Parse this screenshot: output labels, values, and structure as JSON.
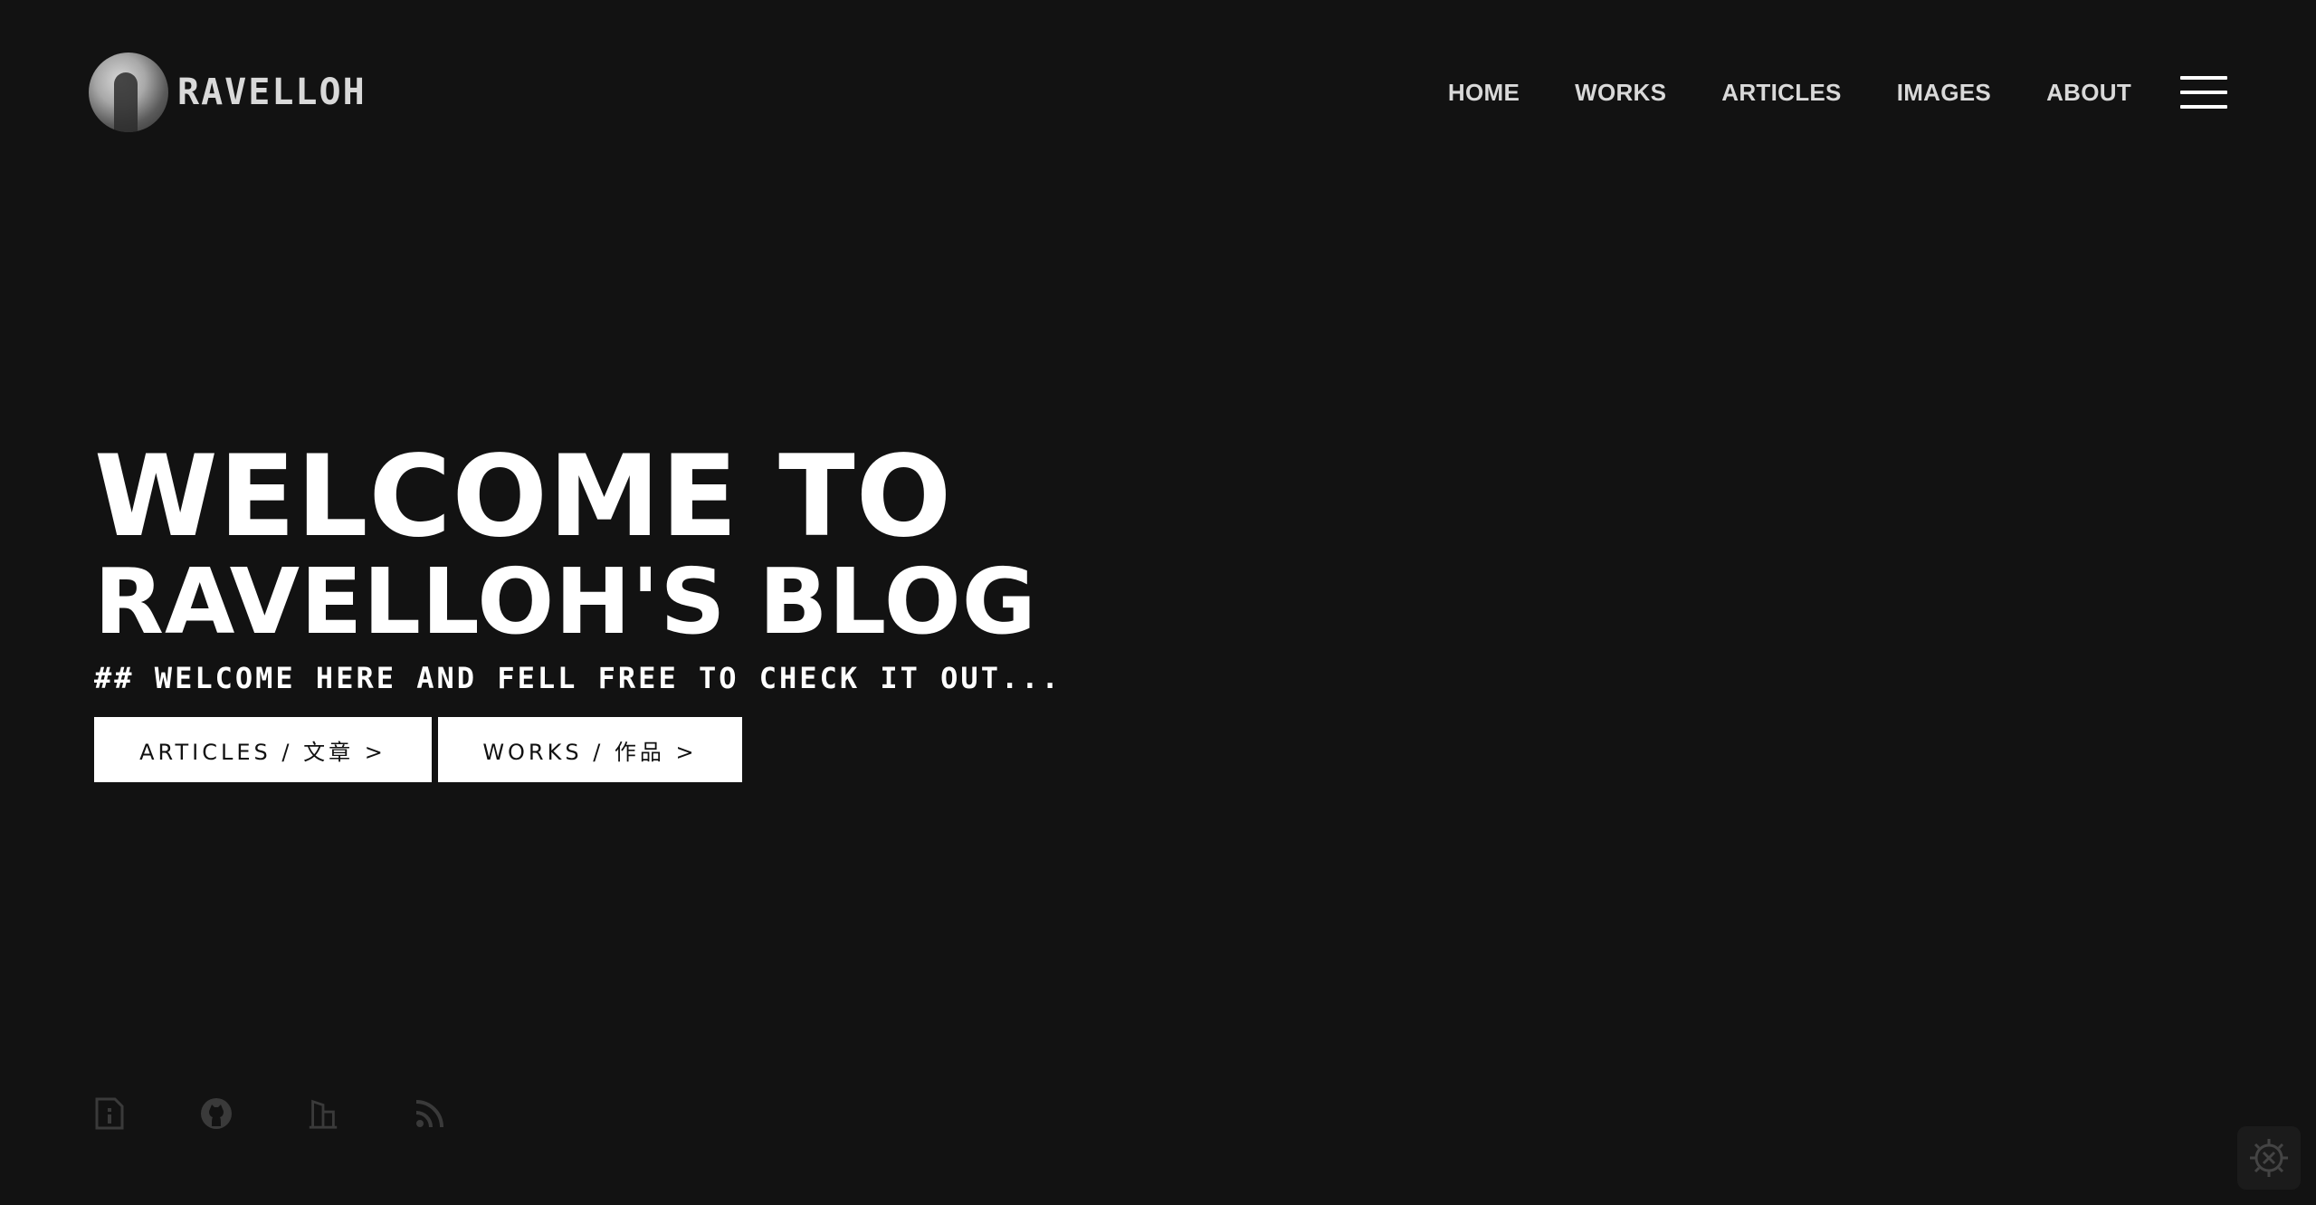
{
  "brand": {
    "name": "RAVELLOH"
  },
  "nav": {
    "items": [
      {
        "label": "HOME"
      },
      {
        "label": "WORKS"
      },
      {
        "label": "ARTICLES"
      },
      {
        "label": "IMAGES"
      },
      {
        "label": "ABOUT"
      }
    ],
    "menu_icon": "hamburger-menu-icon"
  },
  "hero": {
    "title_line1": "WELCOME TO",
    "title_line2": "RAVELLOH'S BLOG",
    "subtitle": "## WELCOME HERE AND FELL FREE TO CHECK IT OUT...",
    "buttons": {
      "articles": "ARTICLES / 文章 >",
      "works": "WORKS / 作品 >"
    }
  },
  "social": {
    "icons": [
      "info-card-icon",
      "github-icon",
      "building-icon",
      "rss-icon"
    ]
  },
  "settings": {
    "icon": "settings-gear-icon"
  },
  "colors": {
    "background": "#121212",
    "text": "#ffffff",
    "nav_text": "#d9d9d9",
    "icon_muted": "#3a3a3a",
    "button_bg": "#ffffff",
    "button_text": "#111111"
  }
}
